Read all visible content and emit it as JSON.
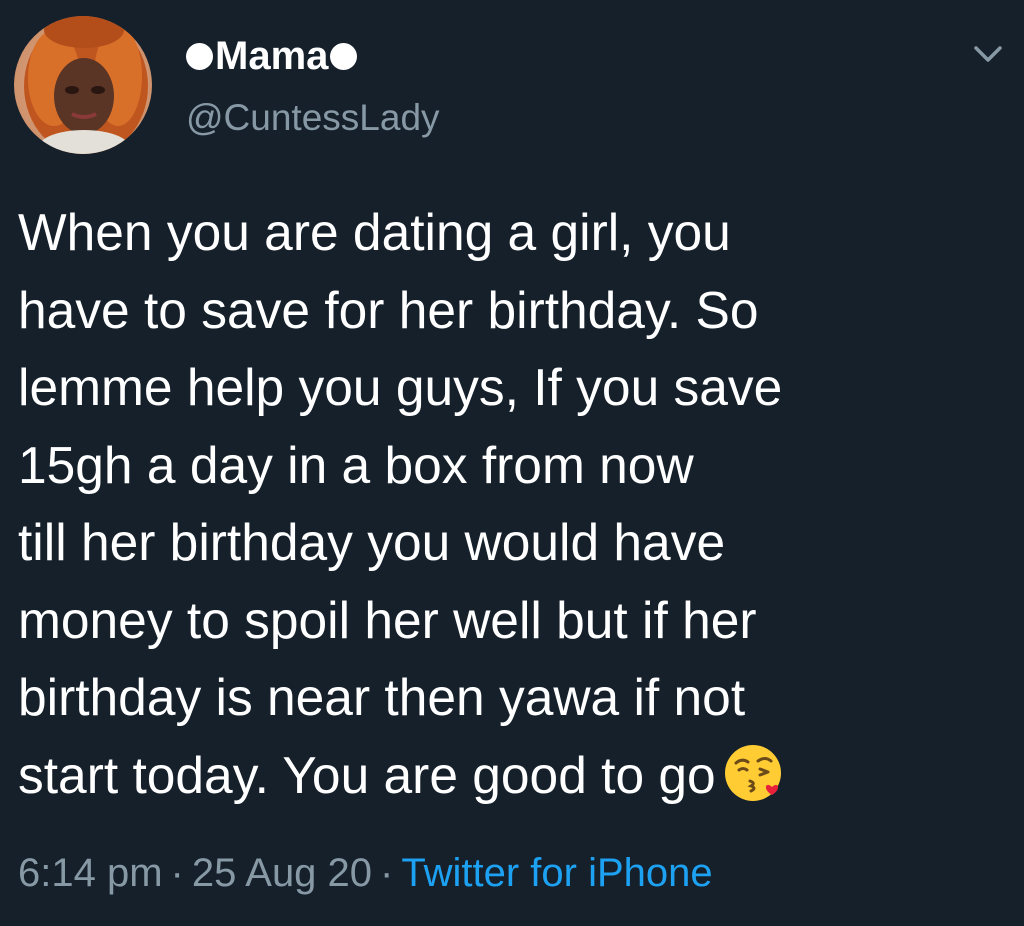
{
  "tweet": {
    "display_name": "Mama",
    "name_decoration_icon": "white-circle-icon",
    "handle": "@CuntessLady",
    "menu_icon": "chevron-down-icon",
    "text_lines": [
      "When you are dating a girl, you",
      "have to save for her birthday. So",
      "lemme help you guys, If you save",
      "15gh a day in a box from now",
      "till her birthday you would have",
      "money to spoil her well but if her",
      "birthday is near then yawa if not",
      "start today. You are good to go"
    ],
    "trailing_emoji": "face-blowing-a-kiss-icon",
    "time": "6:14 pm",
    "separator": "·",
    "date": "25 Aug 20",
    "source": "Twitter for iPhone"
  },
  "colors": {
    "background": "#15202b",
    "primary_text": "#ffffff",
    "secondary_text": "#8899a6",
    "link": "#1da1f2"
  }
}
